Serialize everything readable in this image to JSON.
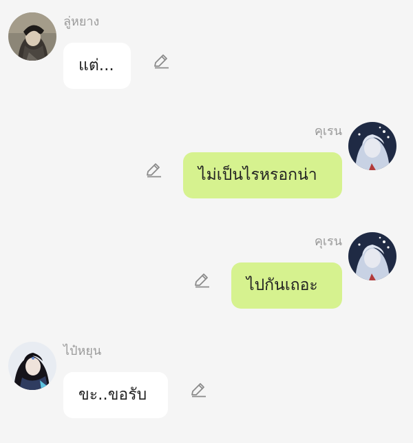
{
  "messages": [
    {
      "sender": "ลู่หยาง",
      "text": "แต่...",
      "side": "left",
      "avatar_icon": "avatar-luyang"
    },
    {
      "sender": "คุเรน",
      "text": "ไม่เป็นไรหรอกน่า",
      "side": "right",
      "avatar_icon": "avatar-kuren"
    },
    {
      "sender": "คุเรน",
      "text": "ไปกันเถอะ",
      "side": "right",
      "avatar_icon": "avatar-kuren"
    },
    {
      "sender": "ไป๋หยุน",
      "text": "ขะ..ขอรับ",
      "side": "left",
      "avatar_icon": "avatar-baiyun"
    }
  ],
  "colors": {
    "background": "#f5f5f5",
    "incoming_bubble": "#ffffff",
    "outgoing_bubble": "#d6f28f",
    "sender_name": "#9a9a9a",
    "edit_icon": "#8a8a8a"
  },
  "icons": {
    "edit": "pencil-icon"
  }
}
